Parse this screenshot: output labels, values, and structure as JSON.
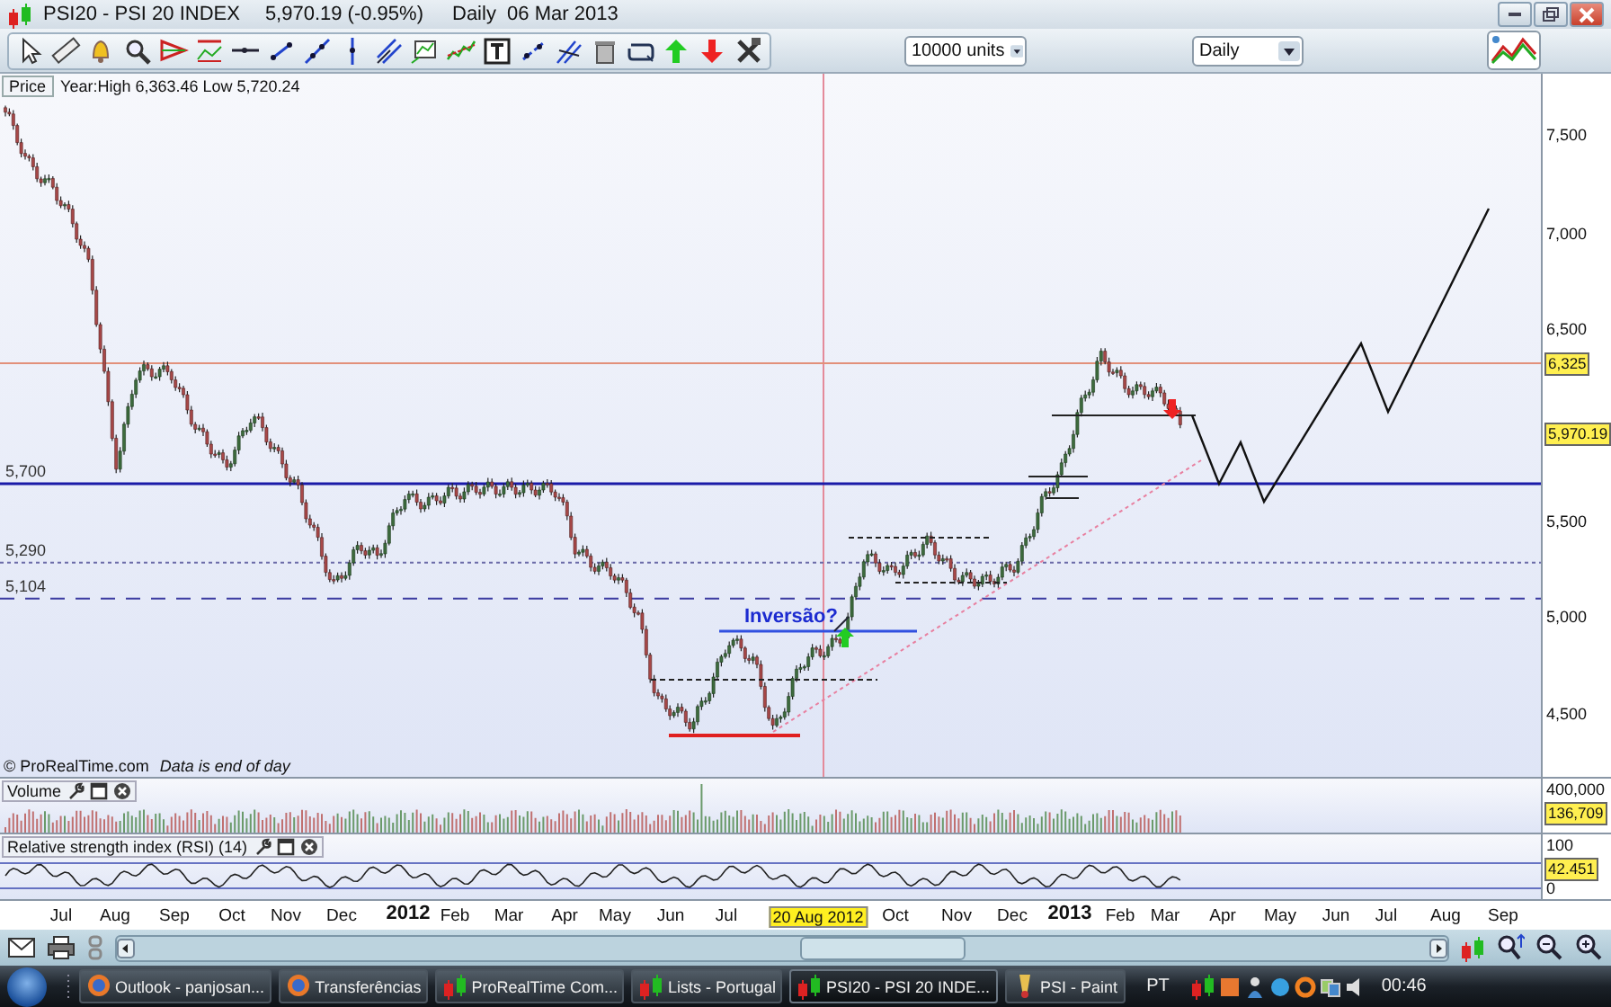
{
  "window": {
    "title": "PSI20 - PSI 20 INDEX",
    "quote": "5,970.19 (-0.95%)",
    "period": "Daily  06 Mar 2013"
  },
  "toolbar": {
    "units": "10000 units",
    "timeframe": "Daily"
  },
  "price_panel": {
    "title": "Price",
    "year_range": "Year:High 6,363.46 Low 5,720.24",
    "axis_labels": [
      {
        "label": "7,500",
        "kind": "tick"
      },
      {
        "label": "7,000",
        "kind": "tick"
      },
      {
        "label": "6,500",
        "kind": "tick"
      },
      {
        "label": "6,325",
        "kind": "marker"
      },
      {
        "label": "5,970.19",
        "kind": "marker"
      },
      {
        "label": "5,500",
        "kind": "tick"
      },
      {
        "label": "5,000",
        "kind": "tick"
      },
      {
        "label": "4,500",
        "kind": "tick"
      }
    ],
    "level_labels": [
      "5,700",
      "5,290",
      "5,104"
    ],
    "annotation": "Inversão?",
    "copyright": "© ProRealTime.com",
    "data_note": "Data is end of day"
  },
  "volume_panel": {
    "title": "Volume",
    "axis_labels": [
      {
        "label": "400,000",
        "kind": "tick"
      },
      {
        "label": "136,709",
        "kind": "marker"
      }
    ]
  },
  "rsi_panel": {
    "title": "Relative strength index (RSI) (14)",
    "axis_labels": [
      {
        "label": "100",
        "kind": "tick"
      },
      {
        "label": "42.451",
        "kind": "marker"
      },
      {
        "label": "0",
        "kind": "tick"
      }
    ]
  },
  "date_axis": [
    {
      "label": "Jul",
      "kind": "month"
    },
    {
      "label": "Aug",
      "kind": "month"
    },
    {
      "label": "Sep",
      "kind": "month"
    },
    {
      "label": "Oct",
      "kind": "month"
    },
    {
      "label": "Nov",
      "kind": "month"
    },
    {
      "label": "Dec",
      "kind": "month"
    },
    {
      "label": "2012",
      "kind": "year"
    },
    {
      "label": "Feb",
      "kind": "month"
    },
    {
      "label": "Mar",
      "kind": "month"
    },
    {
      "label": "Apr",
      "kind": "month"
    },
    {
      "label": "May",
      "kind": "month"
    },
    {
      "label": "Jun",
      "kind": "month"
    },
    {
      "label": "Jul",
      "kind": "month"
    },
    {
      "label": "20 Aug 2012",
      "kind": "cursor"
    },
    {
      "label": "Oct",
      "kind": "month"
    },
    {
      "label": "Nov",
      "kind": "month"
    },
    {
      "label": "Dec",
      "kind": "month"
    },
    {
      "label": "2013",
      "kind": "year"
    },
    {
      "label": "Feb",
      "kind": "month"
    },
    {
      "label": "Mar",
      "kind": "month"
    },
    {
      "label": "Apr",
      "kind": "month"
    },
    {
      "label": "May",
      "kind": "month"
    },
    {
      "label": "Jun",
      "kind": "month"
    },
    {
      "label": "Jul",
      "kind": "month"
    },
    {
      "label": "Aug",
      "kind": "month"
    },
    {
      "label": "Sep",
      "kind": "month"
    }
  ],
  "taskbar": {
    "items": [
      {
        "label": "Outlook - panjosan...",
        "kind": "browser",
        "selected": false
      },
      {
        "label": "Transferências",
        "kind": "browser",
        "selected": false
      },
      {
        "label": "ProRealTime Com...",
        "kind": "chart",
        "selected": false
      },
      {
        "label": "Lists - Portugal",
        "kind": "chart",
        "selected": false
      },
      {
        "label": "PSI20 - PSI 20 INDE...",
        "kind": "chart",
        "selected": true
      },
      {
        "label": "PSI - Paint",
        "kind": "paint",
        "selected": false
      }
    ],
    "language": "PT",
    "clock": "00:46"
  }
}
